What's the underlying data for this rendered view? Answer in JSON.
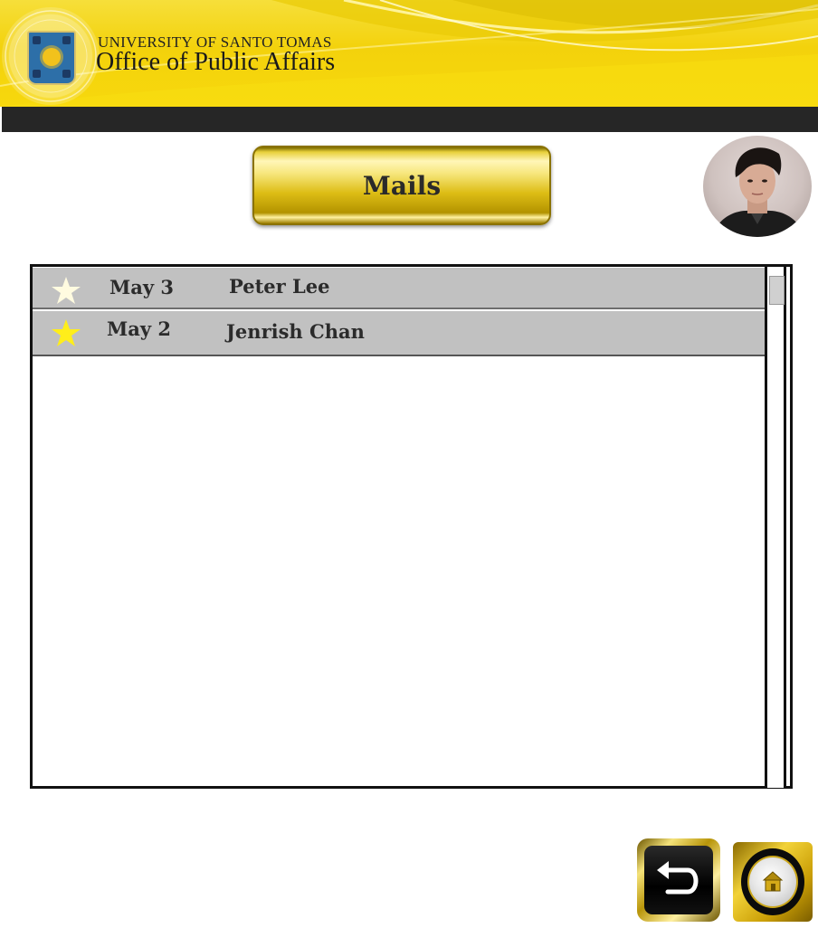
{
  "header": {
    "university": "UNIVERSITY OF SANTO TOMAS",
    "office": "Office of Public Affairs",
    "logo_icon": "university-seal-icon"
  },
  "title_button": {
    "label": "Mails"
  },
  "profile": {
    "avatar_icon": "user-avatar"
  },
  "mail_list": {
    "items": [
      {
        "date": "May 3",
        "sender": "Peter Lee",
        "starred": false,
        "star_color": "#fffbe0"
      },
      {
        "date": "May 2",
        "sender": "Jenrish Chan",
        "starred": true,
        "star_color": "#ffee1a"
      }
    ]
  },
  "footer": {
    "back_icon": "back-arrow-icon",
    "home_icon": "home-icon"
  },
  "colors": {
    "header_yellow": "#f3d20c",
    "header_bar": "#262626",
    "row_gray": "#c1c1c1",
    "gold": "#d4b312"
  }
}
